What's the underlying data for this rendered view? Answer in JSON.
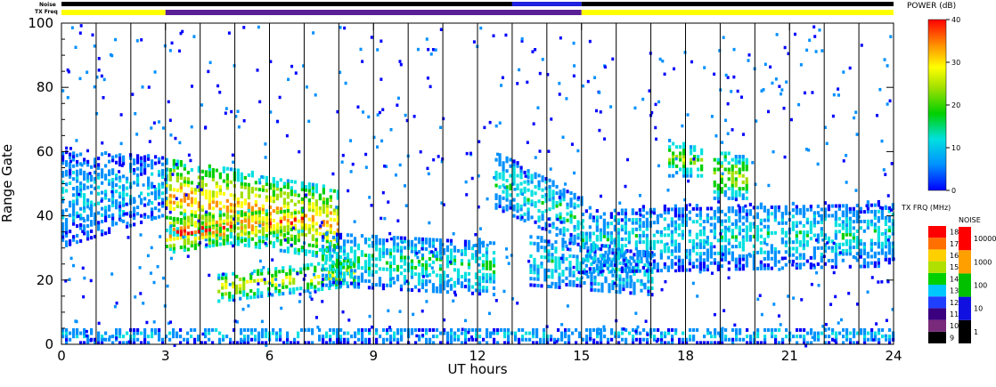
{
  "chart_data": {
    "type": "heatmap",
    "title": "",
    "xlabel": "UT hours",
    "ylabel": "Range Gate",
    "xlim": [
      0,
      24
    ],
    "ylim": [
      0,
      100
    ],
    "x_ticks": [
      0,
      3,
      6,
      9,
      12,
      15,
      18,
      21,
      24
    ],
    "y_ticks": [
      0,
      20,
      40,
      60,
      80,
      100
    ],
    "x_tick_labels": [
      "0",
      "3",
      "6",
      "9",
      "12",
      "15",
      "18",
      "21",
      "24"
    ],
    "y_tick_labels": [
      "0",
      "20",
      "40",
      "60",
      "80",
      "100"
    ],
    "scan_boundaries_ut": [
      1,
      2,
      3,
      4,
      5,
      6,
      7,
      8,
      9,
      10,
      11,
      12,
      13,
      14,
      15,
      16,
      17,
      18,
      19,
      20,
      21,
      22,
      23
    ],
    "status_bars": {
      "noise_label": "Noise",
      "txfreq_label": "TX Freq",
      "txfreq_segments": [
        {
          "start": 0,
          "end": 3,
          "color": "#ffff00"
        },
        {
          "start": 3,
          "end": 15,
          "color": "#5a1e96"
        },
        {
          "start": 15,
          "end": 24,
          "color": "#ffff00"
        }
      ],
      "noise_segments": [
        {
          "start": 0,
          "end": 13,
          "color": "#000000"
        },
        {
          "start": 13,
          "end": 15,
          "color": "#2020e0"
        },
        {
          "start": 15,
          "end": 24,
          "color": "#000000"
        }
      ]
    },
    "power_colorbar": {
      "label": "POWER (dB)",
      "min": 0,
      "max": 40,
      "tick_labels": [
        "0",
        "10",
        "20",
        "30",
        "40"
      ]
    },
    "txfreq_colorbar": {
      "label": "TX FRQ (MHz)",
      "tick_labels": [
        "9",
        "10",
        "11",
        "12",
        "13",
        "14",
        "15",
        "16",
        "17",
        "18"
      ]
    },
    "noise_colorbar": {
      "label": "NOISE",
      "tick_labels": [
        "1",
        "10",
        "100",
        "1000",
        "10000"
      ]
    },
    "echo_regions": [
      {
        "t0": 3.0,
        "t1": 8.0,
        "g0": 34,
        "g1": 58,
        "g0_end": 26,
        "g1_end": 48,
        "power": 28
      },
      {
        "t0": 3.0,
        "t1": 7.0,
        "g0": 28,
        "g1": 40,
        "g0_end": 35,
        "g1_end": 42,
        "power": 32
      },
      {
        "t0": 4.5,
        "t1": 8.5,
        "g0": 13,
        "g1": 22,
        "g0_end": 18,
        "g1_end": 26,
        "power": 24
      },
      {
        "t0": 7.5,
        "t1": 12.5,
        "g0": 18,
        "g1": 34,
        "g0_end": 15,
        "g1_end": 32,
        "power": 14
      },
      {
        "t0": 12.5,
        "t1": 15.0,
        "g0": 42,
        "g1": 60,
        "g0_end": 30,
        "g1_end": 45,
        "power": 14
      },
      {
        "t0": 13.5,
        "t1": 17.0,
        "g0": 18,
        "g1": 34,
        "g0_end": 15,
        "g1_end": 28,
        "power": 12
      },
      {
        "t0": 15.0,
        "t1": 24.0,
        "g0": 22,
        "g1": 42,
        "g0_end": 24,
        "g1_end": 44,
        "power": 12
      },
      {
        "t0": 0.0,
        "t1": 3.0,
        "g0": 30,
        "g1": 60,
        "g0_end": 40,
        "g1_end": 58,
        "power": 10
      },
      {
        "t0": 17.5,
        "t1": 18.5,
        "g0": 52,
        "g1": 64,
        "g0_end": 52,
        "g1_end": 60,
        "power": 20
      },
      {
        "t0": 18.8,
        "t1": 19.8,
        "g0": 45,
        "g1": 60,
        "g0_end": 45,
        "g1_end": 58,
        "power": 22
      },
      {
        "t0": 0.0,
        "t1": 24.0,
        "g0": 0,
        "g1": 5,
        "g0_end": 0,
        "g1_end": 5,
        "power": 10
      }
    ]
  }
}
